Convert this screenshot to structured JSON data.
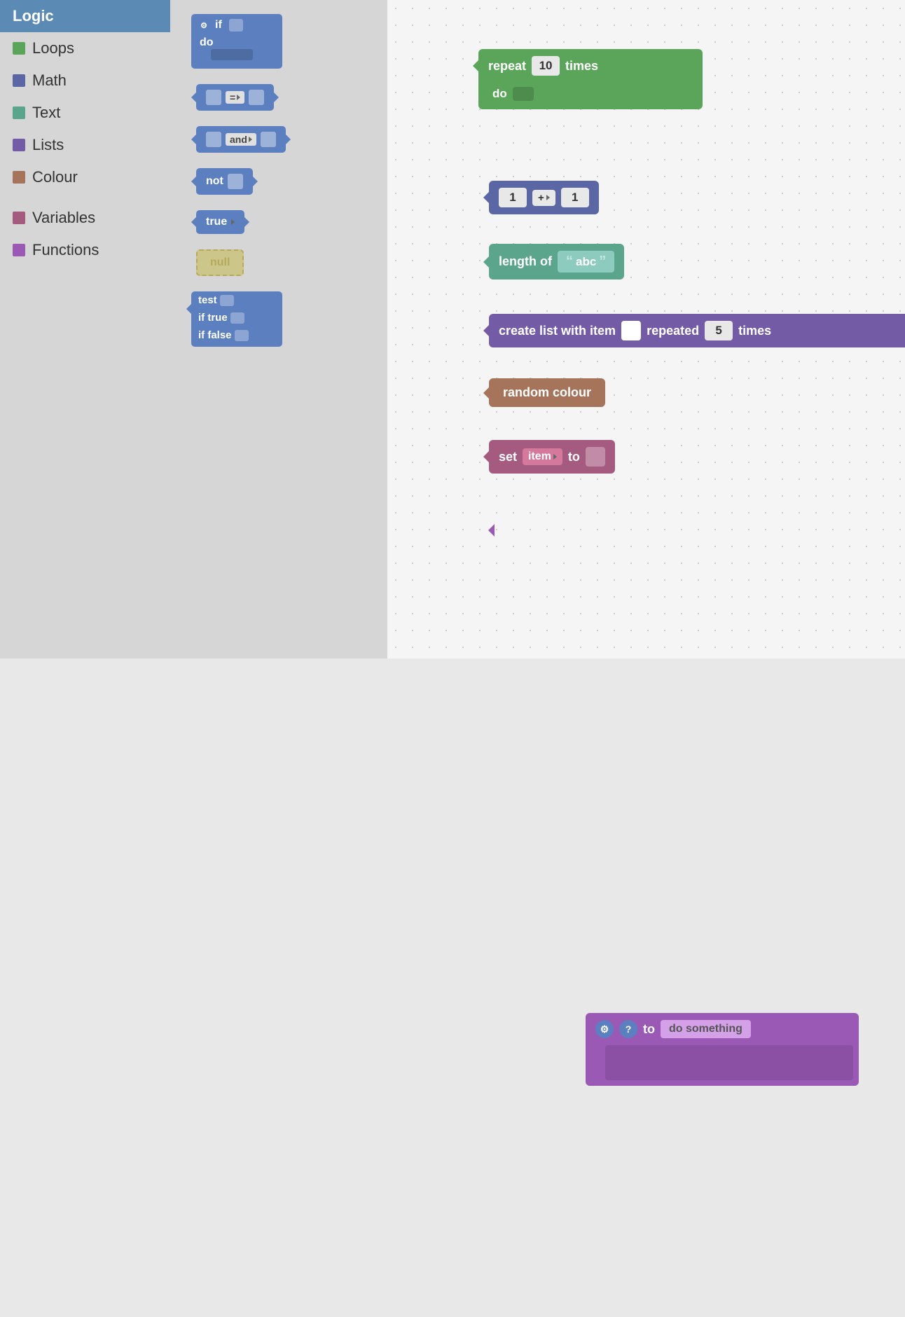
{
  "sidebar": {
    "items": [
      {
        "label": "Logic",
        "color": "#5b7fbf",
        "active": true
      },
      {
        "label": "Loops",
        "color": "#5ba55b",
        "active": false
      },
      {
        "label": "Math",
        "color": "#5b67a5",
        "active": false
      },
      {
        "label": "Text",
        "color": "#5ba58c",
        "active": false
      },
      {
        "label": "Lists",
        "color": "#745ba5",
        "active": false
      },
      {
        "label": "Colour",
        "color": "#a5745b",
        "active": false
      },
      {
        "label": "Variables",
        "color": "#a55b80",
        "active": false
      },
      {
        "label": "Functions",
        "color": "#9b59b6",
        "active": false
      }
    ]
  },
  "blocks_panel": {
    "if_block": {
      "label_if": "if",
      "label_do": "do"
    },
    "eq_block": {
      "op": "="
    },
    "and_block": {
      "op": "and"
    },
    "not_block": {
      "label": "not"
    },
    "true_block": {
      "label": "true"
    },
    "null_block": {
      "label": "null"
    },
    "ternary_block": {
      "label_test": "test",
      "label_if_true": "if true",
      "label_if_false": "if false"
    }
  },
  "workspace": {
    "repeat_block": {
      "label_repeat": "repeat",
      "value": "10",
      "label_times": "times",
      "label_do": "do"
    },
    "math_block": {
      "left": "1",
      "op": "+",
      "right": "1"
    },
    "text_length_block": {
      "label": "length of",
      "value": "abc"
    },
    "lists_block": {
      "label_create": "create list with item",
      "label_repeated": "repeated",
      "value": "5",
      "label_times": "times"
    },
    "colour_block": {
      "label": "random colour"
    },
    "variables_block": {
      "label_set": "set",
      "var_name": "item",
      "label_to": "to"
    },
    "functions_block": {
      "label_to": "to",
      "label_do_something": "do something"
    }
  }
}
